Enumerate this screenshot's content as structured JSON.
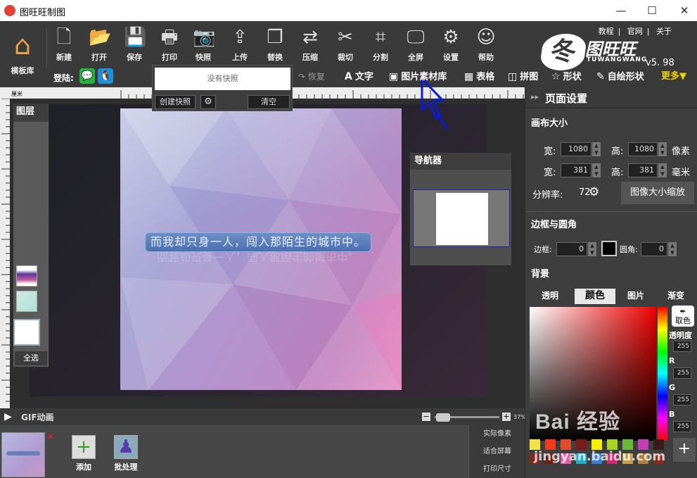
{
  "window": {
    "title": "图旺旺制图",
    "minimize": "—",
    "maximize": "☐",
    "close": "✕"
  },
  "toolbar": {
    "template_library": "模板库",
    "tools": [
      {
        "label": "新建",
        "icon": "new-file-icon",
        "glyph": "🗋"
      },
      {
        "label": "打开",
        "icon": "folder-open-icon",
        "glyph": "📂"
      },
      {
        "label": "保存",
        "icon": "save-icon",
        "glyph": "💾"
      },
      {
        "label": "打印",
        "icon": "printer-icon",
        "glyph": "🖶"
      },
      {
        "label": "快照",
        "icon": "camera-icon",
        "glyph": "📷"
      },
      {
        "label": "上传",
        "icon": "upload-icon",
        "glyph": "⇪"
      },
      {
        "label": "替换",
        "icon": "replace-icon",
        "glyph": "❐"
      },
      {
        "label": "压缩",
        "icon": "compress-icon",
        "glyph": "⇄"
      },
      {
        "label": "裁切",
        "icon": "scissors-icon",
        "glyph": "✂"
      },
      {
        "label": "分割",
        "icon": "crop-icon",
        "glyph": "⌗"
      },
      {
        "label": "全屏",
        "icon": "monitor-icon",
        "glyph": "🖵"
      },
      {
        "label": "设置",
        "icon": "gear-icon",
        "glyph": "⚙"
      },
      {
        "label": "帮助",
        "icon": "help-icon",
        "glyph": "☺"
      }
    ],
    "login_label": "登陆:",
    "top_links": [
      "教程",
      "官网",
      "关于"
    ]
  },
  "logo": {
    "mark": "冬",
    "name": "图旺旺",
    "sub": "TUWANGWANG",
    "version": "v5. 98"
  },
  "menu2": {
    "restore": "恢复",
    "items": [
      {
        "label": "文字",
        "icon": "text-icon",
        "glyph": "A"
      },
      {
        "label": "图片素材库",
        "icon": "image-library-icon",
        "glyph": "▣"
      },
      {
        "label": "表格",
        "icon": "table-icon",
        "glyph": "▦"
      },
      {
        "label": "拼图",
        "icon": "collage-icon",
        "glyph": "◫"
      },
      {
        "label": "形状",
        "icon": "star-shape-icon",
        "glyph": "☆"
      },
      {
        "label": "自绘形状",
        "icon": "pen-icon",
        "glyph": "✎"
      }
    ],
    "more": "更多▼"
  },
  "snapshot_popup": {
    "empty_text": "没有快照",
    "create": "创建快照",
    "clear": "清空"
  },
  "ruler": {
    "unit": "厘米"
  },
  "canvas": {
    "text": "而我却只身一人，闯入那陌生的城市中。"
  },
  "layers": {
    "title": "图层",
    "select_all": "全选"
  },
  "navigator": {
    "title": "导航器"
  },
  "bottom": {
    "gif_label": "GIF动画",
    "zoom": "37%",
    "add": "添加",
    "batch": "批处理",
    "size_options": [
      "实际像素",
      "适合屏幕",
      "打印尺寸"
    ]
  },
  "right_panel": {
    "title": "页面设置",
    "canvas_size": "画布大小",
    "width_label": "宽:",
    "height_label": "高:",
    "width_px": "1080",
    "height_px": "1080",
    "px_unit": "像素",
    "width_mm": "381",
    "height_mm": "381",
    "mm_unit": "毫米",
    "resolution_label": "分辨率:",
    "resolution": "72",
    "scale_button": "图像大小缩放",
    "border_section": "边框与圆角",
    "border_label": "边框:",
    "border_value": "0",
    "radius_label": "圆角:",
    "radius_value": "0",
    "background_section": "背景",
    "bg_tabs": [
      "透明",
      "颜色",
      "图片",
      "渐变"
    ],
    "eyedropper": "取色",
    "opacity_label": "透明度",
    "channels": [
      {
        "label": "",
        "value": "255"
      },
      {
        "label": "R",
        "value": "255"
      },
      {
        "label": "G",
        "value": "255"
      },
      {
        "label": "B",
        "value": "255"
      }
    ],
    "swatch_colors": [
      "#f2e14b",
      "#f23a1d",
      "#e24a2b",
      "#7a1a1a",
      "#f5f000",
      "#a8d42a",
      "#6cb83a",
      "#c43fb5",
      "#3a1a1a",
      "#7a2a1a",
      "#6d2014",
      "#e05fa8",
      "#1fb0c8",
      "#3a7fd6",
      "#d02a6a",
      "#c8a050",
      "#b08040",
      "#8a2a1a"
    ]
  },
  "watermark": {
    "brand": "Bai 经验",
    "url": "jingyan.baidu.com"
  },
  "colors": {
    "panel": "#3e3e3e",
    "toolbar": "#3a3a3a",
    "accent_more": "#f0d400",
    "pointer": "#0a1ad6"
  }
}
